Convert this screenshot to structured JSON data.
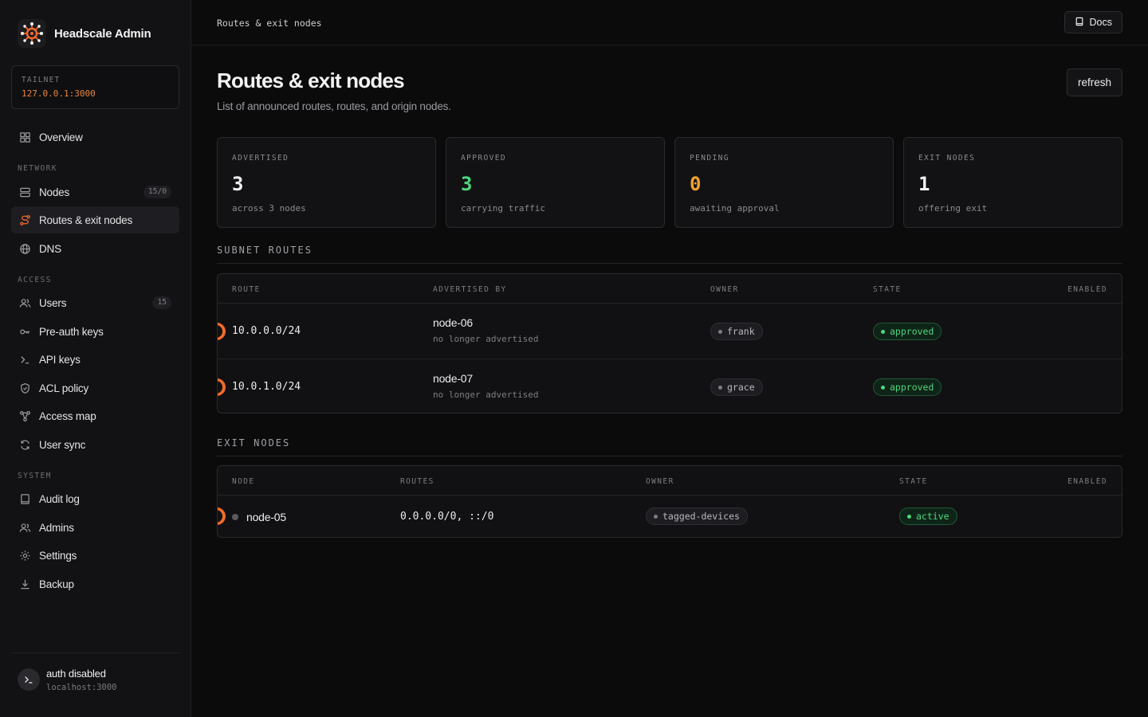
{
  "app": {
    "name": "Headscale Admin"
  },
  "tailnet": {
    "label": "TAILNET",
    "value": "127.0.0.1:3000"
  },
  "nav": {
    "overview": "Overview",
    "network_label": "NETWORK",
    "nodes": "Nodes",
    "nodes_badge": "15/0",
    "routes": "Routes & exit nodes",
    "dns": "DNS",
    "access_label": "ACCESS",
    "users": "Users",
    "users_badge": "15",
    "preauth": "Pre-auth keys",
    "apikeys": "API keys",
    "acl": "ACL policy",
    "accessmap": "Access map",
    "usersync": "User sync",
    "system_label": "SYSTEM",
    "audit": "Audit log",
    "admins": "Admins",
    "settings": "Settings",
    "backup": "Backup"
  },
  "footer": {
    "title": "auth disabled",
    "subtitle": "localhost:3000"
  },
  "topbar": {
    "breadcrumb": "Routes & exit nodes",
    "docs_label": "Docs"
  },
  "page": {
    "title": "Routes & exit nodes",
    "subtitle": "List of announced routes, routes, and origin nodes.",
    "refresh_label": "refresh"
  },
  "stats": [
    {
      "label": "ADVERTISED",
      "value": "3",
      "sub": "across 3 nodes",
      "color": "#f0f0f2"
    },
    {
      "label": "APPROVED",
      "value": "3",
      "sub": "carrying traffic",
      "color": "#4fd67e"
    },
    {
      "label": "PENDING",
      "value": "0",
      "sub": "awaiting approval",
      "color": "#f0a030"
    },
    {
      "label": "EXIT NODES",
      "value": "1",
      "sub": "offering exit",
      "color": "#f0f0f2"
    }
  ],
  "subnet": {
    "title": "SUBNET ROUTES",
    "headers": {
      "route": "ROUTE",
      "advertised_by": "ADVERTISED BY",
      "owner": "OWNER",
      "state": "STATE",
      "enabled": "ENABLED"
    },
    "rows": [
      {
        "route": "10.0.0.0/24",
        "node": "node-06",
        "note": "no longer advertised",
        "owner": "frank",
        "state": "approved",
        "enabled": true
      },
      {
        "route": "10.0.1.0/24",
        "node": "node-07",
        "note": "no longer advertised",
        "owner": "grace",
        "state": "approved",
        "enabled": true
      }
    ]
  },
  "exit": {
    "title": "EXIT NODES",
    "headers": {
      "node": "NODE",
      "routes": "ROUTES",
      "owner": "OWNER",
      "state": "STATE",
      "enabled": "ENABLED"
    },
    "rows": [
      {
        "node": "node-05",
        "routes": "0.0.0.0/0, ::/0",
        "owner": "tagged-devices",
        "state": "active",
        "enabled": true
      }
    ]
  },
  "colors": {
    "accent": "#f26a2e",
    "success": "#4fd67e",
    "warning": "#f0a030",
    "tailnet": "#e7843f"
  }
}
